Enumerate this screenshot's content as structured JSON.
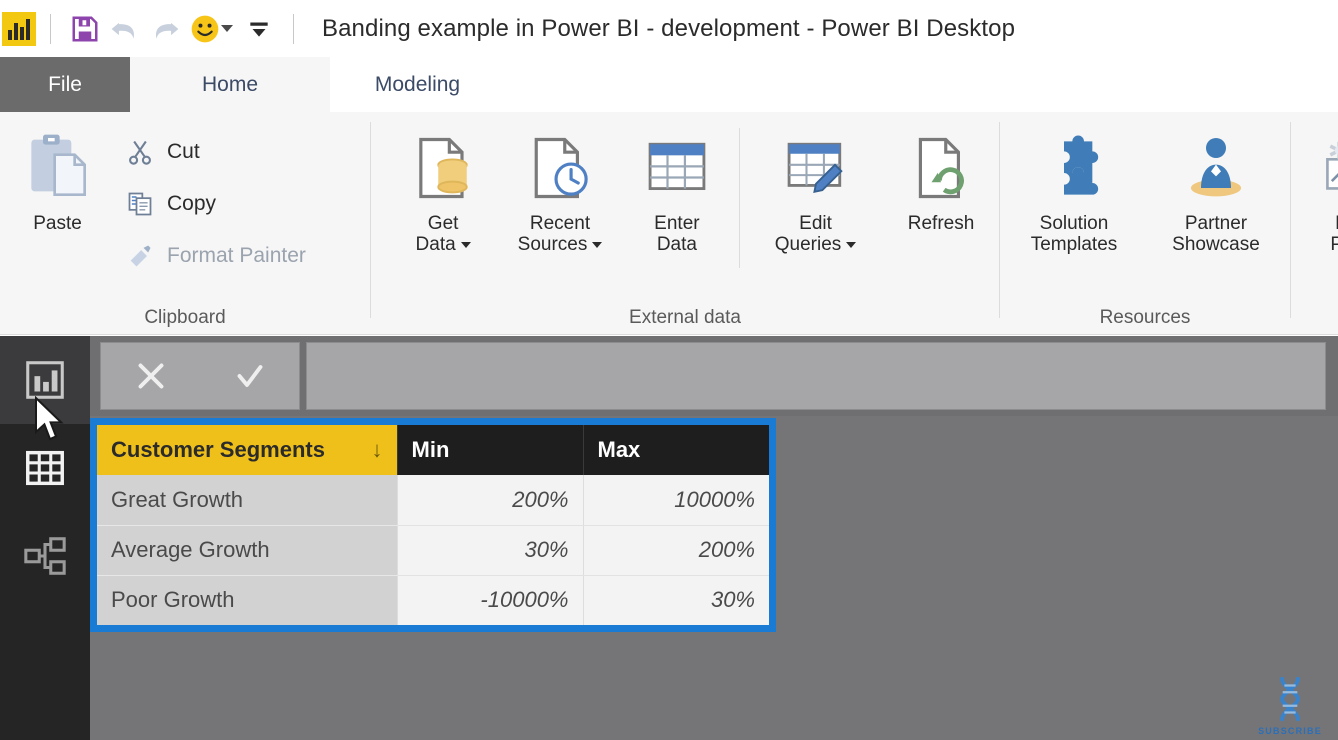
{
  "window": {
    "title": "Banding example in Power BI - development - Power BI Desktop",
    "app_logo_name": "power-bi-logo"
  },
  "quick_access": {
    "save_label": "Save",
    "undo_label": "Undo",
    "redo_label": "Redo",
    "smiley_label": "Send a Smile",
    "customize_label": "Customize Quick Access Toolbar"
  },
  "tabs": [
    {
      "id": "file",
      "label": "File",
      "active": false
    },
    {
      "id": "home",
      "label": "Home",
      "active": true
    },
    {
      "id": "modeling",
      "label": "Modeling",
      "active": false
    }
  ],
  "ribbon": {
    "groups": [
      {
        "id": "clipboard",
        "label": "Clipboard",
        "big": [
          {
            "id": "paste",
            "label": "Paste",
            "icon": "clipboard-icon"
          }
        ],
        "small": [
          {
            "id": "cut",
            "label": "Cut",
            "icon": "scissors-icon",
            "enabled": true
          },
          {
            "id": "copy",
            "label": "Copy",
            "icon": "copy-icon",
            "enabled": true
          },
          {
            "id": "format-painter",
            "label": "Format Painter",
            "icon": "paintbrush-icon",
            "enabled": false
          }
        ]
      },
      {
        "id": "external-data",
        "label": "External data",
        "big": [
          {
            "id": "get-data",
            "label": "Get\nData",
            "icon": "database-page-icon",
            "caret": true
          },
          {
            "id": "recent-sources",
            "label": "Recent\nSources",
            "icon": "page-clock-icon",
            "caret": true
          },
          {
            "id": "enter-data",
            "label": "Enter\nData",
            "icon": "table-icon",
            "caret": false
          },
          {
            "id": "edit-queries",
            "label": "Edit\nQueries",
            "icon": "table-pencil-icon",
            "caret": true
          },
          {
            "id": "refresh",
            "label": "Refresh",
            "icon": "page-refresh-icon",
            "caret": false
          }
        ],
        "small": []
      },
      {
        "id": "resources",
        "label": "Resources",
        "big": [
          {
            "id": "solution-templates",
            "label": "Solution\nTemplates",
            "icon": "puzzle-icon",
            "caret": false
          },
          {
            "id": "partner-showcase",
            "label": "Partner\nShowcase",
            "icon": "person-icon",
            "caret": false
          }
        ],
        "small": []
      },
      {
        "id": "overflow",
        "label": "",
        "big": [
          {
            "id": "new-page",
            "label": "N\nPa",
            "icon": "new-page-icon",
            "caret": false
          }
        ],
        "small": []
      }
    ]
  },
  "leftnav": {
    "items": [
      {
        "id": "report",
        "label": "Report view",
        "icon": "bar-chart-icon",
        "selected": true
      },
      {
        "id": "data",
        "label": "Data view",
        "icon": "table-grid-icon",
        "selected": false
      },
      {
        "id": "model",
        "label": "Model view",
        "icon": "relationships-icon",
        "selected": false
      }
    ]
  },
  "formula_bar": {
    "cancel_label": "Cancel",
    "confirm_label": "Confirm",
    "value": "",
    "placeholder": ""
  },
  "table": {
    "columns": [
      {
        "id": "segments",
        "label": "Customer Segments",
        "sorted": true,
        "sort_glyph": "↓",
        "align": "left"
      },
      {
        "id": "min",
        "label": "Min",
        "sorted": false,
        "align": "left"
      },
      {
        "id": "max",
        "label": "Max",
        "sorted": false,
        "align": "left"
      }
    ],
    "rows": [
      {
        "segment": "Great Growth",
        "min": "200%",
        "max": "10000%"
      },
      {
        "segment": "Average Growth",
        "min": "30%",
        "max": "200%"
      },
      {
        "segment": "Poor Growth",
        "min": "-10000%",
        "max": "30%"
      }
    ]
  },
  "watermark": {
    "text": "SUBSCRIBE",
    "icon": "dna-helix-icon"
  },
  "colors": {
    "brand_yellow": "#F2C811",
    "header_gold": "#F0C01A",
    "header_dark": "#1E1E1E",
    "selection_blue": "#1A7BD4",
    "canvas_gray": "#757577",
    "ribbon_bg": "#F6F6F6",
    "nav_bg": "#252526",
    "save_purple": "#8E44AD"
  }
}
